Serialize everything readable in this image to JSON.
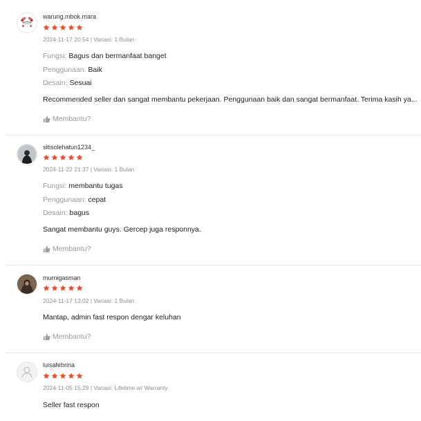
{
  "colors": {
    "star": "#ee4d2d",
    "muted": "#9a9a9a",
    "divider": "#e8e8e8"
  },
  "reviews": [
    {
      "username": "warung.mbok.mara",
      "avatar_icon": "shop-logo-avatar",
      "rating": 5,
      "meta": "2024-11-17 20:54 | Variasi: 1 Bulan",
      "attributes": [
        {
          "label": "Fungsi: ",
          "value": "Bagus dan bermanfaat banget"
        },
        {
          "label": "Penggunaan: ",
          "value": "Baik"
        },
        {
          "label": "Desain: ",
          "value": "Sesuai"
        }
      ],
      "comment": "Recommended seller dan sangat membantu pekerjaan. Penggunaan baik dan sangat bermanfaat. Terima kasih ya...",
      "helpful_label": "Membantu?"
    },
    {
      "username": "sitisolehatun1234_",
      "avatar_icon": "user-photo-avatar",
      "rating": 5,
      "meta": "2024-11-22 21:37 | Variasi: 1 Bulan",
      "attributes": [
        {
          "label": "Fungsi: ",
          "value": "membantu tugas"
        },
        {
          "label": "Penggunaan: ",
          "value": "cepat"
        },
        {
          "label": "Desain: ",
          "value": "bagus"
        }
      ],
      "comment": "Sangat membantu guys. Gercep juga responnya.",
      "helpful_label": "Membantu?"
    },
    {
      "username": "murnigasman",
      "avatar_icon": "user-photo-avatar",
      "rating": 5,
      "meta": "2024-11-17 13:02 | Variasi: 1 Bulan",
      "comment": "Mantap, admin fast respon dengar keluhan",
      "helpful_label": "Membantu?"
    },
    {
      "username": "luisafebrina",
      "avatar_icon": "default-user-avatar",
      "rating": 5,
      "meta": "2024-11-05 15:29 | Variasi: Lifetime w/ Warranty",
      "comment": "Seller fast respon"
    }
  ]
}
